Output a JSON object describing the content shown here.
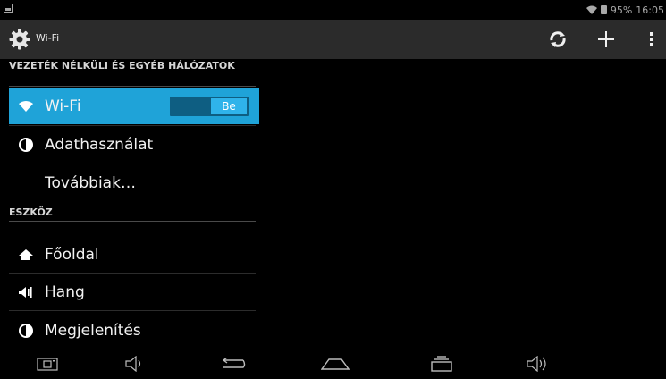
{
  "statusbar": {
    "battery": "95%",
    "time": "16:05"
  },
  "actionbar": {
    "title": "Wi-Fi"
  },
  "sections": {
    "wireless": "VEZETÉK NÉLKÜLI ÉS EGYÉB HÁLÓZATOK",
    "device": "ESZKÖZ"
  },
  "items": {
    "wifi": {
      "label": "Wi-Fi",
      "toggle": "Be"
    },
    "data_usage": {
      "label": "Adathasználat"
    },
    "more": {
      "label": "Továbbiak…"
    },
    "home": {
      "label": "Főoldal"
    },
    "sound": {
      "label": "Hang"
    },
    "display": {
      "label": "Megjelenítés"
    }
  },
  "colors": {
    "accent": "#1fa3d8",
    "toggle_on": "#2fb3ea",
    "actionbar": "#2b2b2b"
  }
}
